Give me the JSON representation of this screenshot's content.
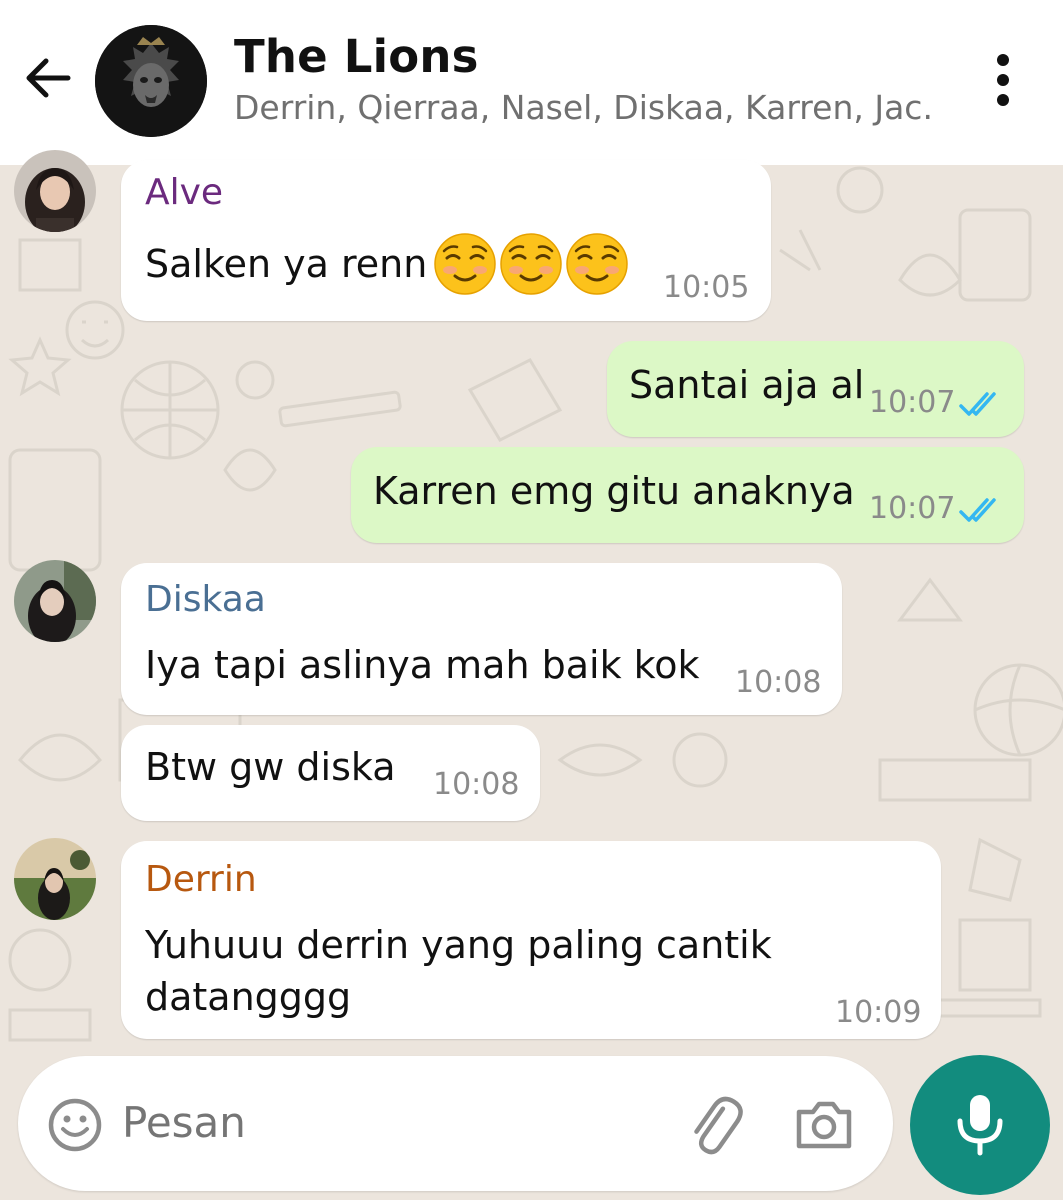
{
  "header": {
    "title": "The Lions",
    "subtitle": "Derrin, Qierraa, Nasel, Diskaa, Karren, Jac.."
  },
  "messages": [
    {
      "sender": "Alve",
      "text": "Salken ya renn",
      "time": "10:05",
      "emoji": "☺️☺️☺️"
    },
    {
      "text": "Santai aja al",
      "time": "10:07",
      "status": "read"
    },
    {
      "text": "Karren emg gitu anaknya",
      "time": "10:07",
      "status": "read"
    },
    {
      "sender": "Diskaa",
      "text": "Iya tapi aslinya mah baik kok",
      "time": "10:08"
    },
    {
      "text": "Btw gw diska",
      "time": "10:08"
    },
    {
      "sender": "Derrin",
      "line1": "Yuhuuu derrin yang paling cantik",
      "line2": "datangggg",
      "time": "10:09"
    }
  ],
  "composer": {
    "placeholder": "Pesan"
  },
  "colors": {
    "alve": "#6b2a7e",
    "diskaa": "#4a6f93",
    "derrin": "#b7580f",
    "outgoing_bubble": "#dcf8c6",
    "read_ticks": "#34b7f1",
    "accent": "#128c7e"
  },
  "icons": {
    "back": "arrow-left-icon",
    "menu": "more-vertical-icon",
    "emoji": "emoji-icon",
    "attach": "paperclip-icon",
    "camera": "camera-icon",
    "mic": "microphone-icon"
  }
}
